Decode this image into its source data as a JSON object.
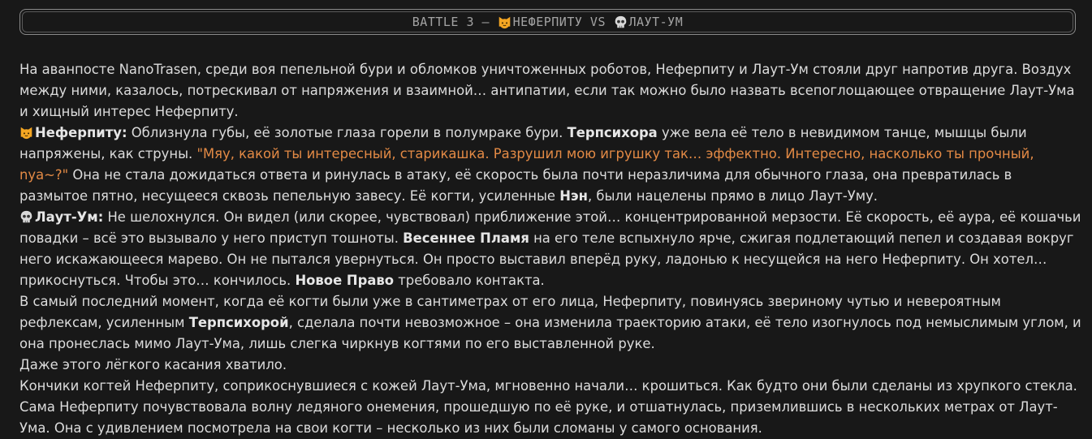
{
  "header": {
    "prefix": "BATTLE 3 – ",
    "fighter1": "НЕФЕРПИТУ",
    "vs": " VS ",
    "fighter2": "ЛАУТ-УМ",
    "fighter1_icon": "cat-face-icon",
    "fighter2_icon": "skull-icon"
  },
  "colors": {
    "background": "#181818",
    "text": "#dcdcdc",
    "quote": "#e38a45",
    "header_text": "#a3a3a3"
  },
  "story": {
    "p1": "На аванпосте NanoTrasen, среди воя пепельной бури и обломков уничтоженных роботов, Неферпиту и Лаут-Ум стояли друг напротив друга. Воздух между ними, казалось, потрескивал от напряжения и взаимной… антипатии, если так можно было назвать всепоглощающее отвращение Лаут-Ума и хищный интерес Неферпиту.",
    "p2": {
      "name": "Неферпиту:",
      "t1": " Облизнула губы, её золотые глаза горели в полумраке бури. ",
      "b1": "Терпсихора",
      "t2": " уже вела её тело в невидимом танце, мышцы были напряжены, как струны. ",
      "quote": "\"Мяу, какой ты интересный, старикашка. Разрушил мою игрушку так… эффектно. Интересно, насколько ты прочный, nya~?\"",
      "t3": " Она не стала дожидаться ответа и ринулась в атаку, её скорость была почти неразличима для обычного глаза, она превратилась в размытое пятно, несущееся сквозь пепельную завесу. Её когти, усиленные ",
      "b2": "Нэн",
      "t4": ", были нацелены прямо в лицо Лаут-Уму."
    },
    "p3": {
      "name": "Лаут-Ум:",
      "t1": " Не шелохнулся. Он видел (или скорее, чувствовал) приближение этой… концентрированной мерзости. Её скорость, её аура, её кошачьи повадки – всё это вызывало у него приступ тошноты. ",
      "b1": "Весеннее Пламя",
      "t2": " на его теле вспыхнуло ярче, сжигая подлетающий пепел и создавая вокруг него искажающееся марево. Он не пытался увернуться. Он просто выставил вперёд руку, ладонью к несущейся на него Неферпиту. Он хотел… прикоснуться. Чтобы это… кончилось. ",
      "b2": "Новое Право",
      "t3": " требовало контакта."
    },
    "p4": {
      "t1": "В самый последний момент, когда её когти были уже в сантиметрах от его лица, Неферпиту, повинуясь звериному чутью и невероятным рефлексам, усиленным ",
      "b1": "Терпсихорой",
      "t2": ", сделала почти невозможное – она изменила траекторию атаки, её тело изогнулось под немыслимым углом, и она пронеслась мимо Лаут-Ума, лишь слегка чиркнув когтями по его выставленной руке."
    },
    "p5": "Даже этого лёгкого касания хватило.",
    "p6": "Кончики когтей Неферпиту, соприкоснувшиеся с кожей Лаут-Ума, мгновенно начали… крошиться. Как будто они были сделаны из хрупкого стекла. Сама Неферпиту почувствовала волну ледяного онемения, прошедшую по её руке, и отшатнулась, приземлившись в нескольких метрах от Лаут-Ума. Она с удивлением посмотрела на свои когти – несколько из них были сломаны у самого основания."
  }
}
